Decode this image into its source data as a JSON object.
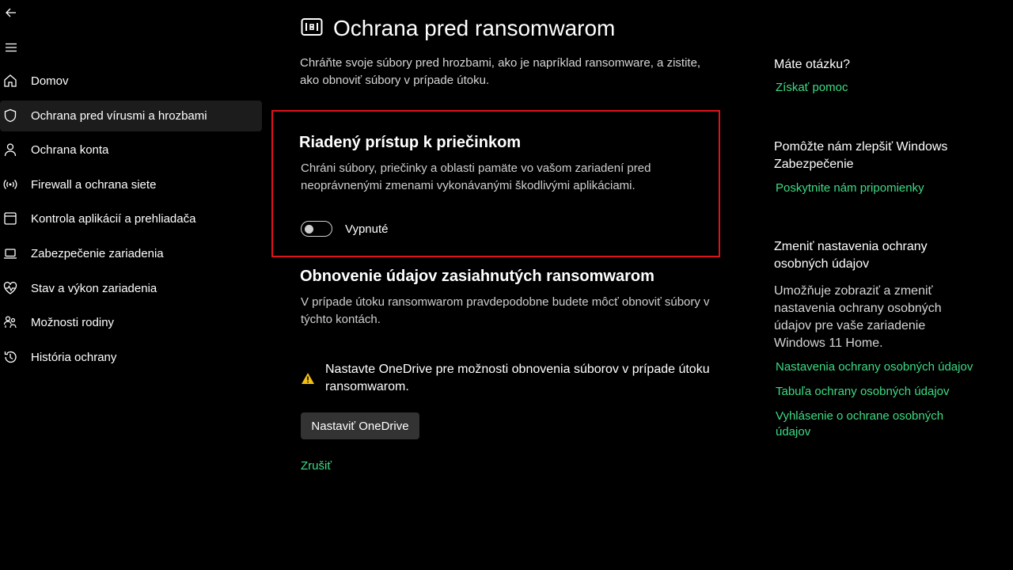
{
  "page": {
    "title": "Ochrana pred ransomwarom",
    "description": "Chráňte svoje súbory pred hrozbami, ako je napríklad ransomware, a zistite, ako obnoviť súbory v prípade útoku."
  },
  "sidebar": {
    "items": [
      {
        "label": "Domov",
        "icon": "home-icon"
      },
      {
        "label": "Ochrana pred vírusmi a hrozbami",
        "icon": "shield-icon"
      },
      {
        "label": "Ochrana konta",
        "icon": "person-icon"
      },
      {
        "label": "Firewall a ochrana siete",
        "icon": "wifi-antenna-icon"
      },
      {
        "label": "Kontrola aplikácií a prehliadača",
        "icon": "app-window-icon"
      },
      {
        "label": "Zabezpečenie zariadenia",
        "icon": "laptop-icon"
      },
      {
        "label": "Stav a výkon zariadenia",
        "icon": "heart-pulse-icon"
      },
      {
        "label": "Možnosti rodiny",
        "icon": "family-icon"
      },
      {
        "label": "História ochrany",
        "icon": "history-icon"
      }
    ]
  },
  "cfa": {
    "title": "Riadený prístup k priečinkom",
    "description": "Chráni súbory, priečinky a oblasti pamäte vo vašom zariadení pred neoprávnenými zmenami vykonávanými škodlivými aplikáciami.",
    "toggle_state": "Vypnuté",
    "toggle_on": false
  },
  "recovery": {
    "title": "Obnovenie údajov zasiahnutých ransomwarom",
    "description": "V prípade útoku ransomwarom pravdepodobne budete môcť obnoviť súbory v týchto kontách.",
    "warning": "Nastavte OneDrive pre možnosti obnovenia súborov v prípade útoku ransomwarom.",
    "button": "Nastaviť OneDrive",
    "dismiss": "Zrušiť"
  },
  "right": {
    "question_title": "Máte otázku?",
    "get_help": "Získať pomoc",
    "improve_title": "Pomôžte nám zlepšiť Windows Zabezpečenie",
    "feedback": "Poskytnite nám pripomienky",
    "privacy_title": "Zmeniť nastavenia ochrany osobných údajov",
    "privacy_text": "Umožňuje zobraziť a zmeniť nastavenia ochrany osobných údajov pre vaše zariadenie Windows 11 Home.",
    "links": [
      "Nastavenia ochrany osobných údajov",
      "Tabuľa ochrany osobných údajov",
      "Vyhlásenie o ochrane osobných údajov"
    ]
  },
  "colors": {
    "background": "#000000",
    "accent_link": "#3ddc84",
    "highlight_border": "#e0131a",
    "warning": "#f2c012"
  }
}
